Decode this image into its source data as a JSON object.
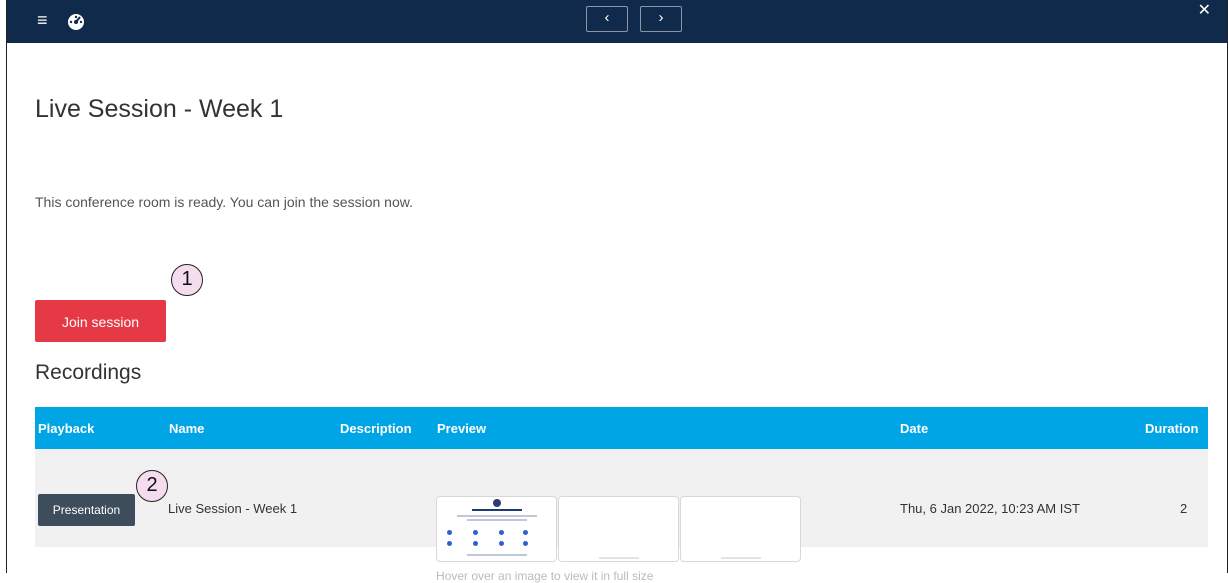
{
  "navbar": {
    "menu_glyph": "≡",
    "prev_glyph": "‹",
    "next_glyph": "›",
    "close_glyph": "✕"
  },
  "page": {
    "title": "Live Session - Week 1",
    "status_text": "This conference room is ready. You can join the session now.",
    "join_label": "Join session",
    "recordings_heading": "Recordings"
  },
  "callouts": [
    "1",
    "2"
  ],
  "table": {
    "headers": [
      "Playback",
      "Name",
      "Description",
      "Preview",
      "Date",
      "Duration"
    ],
    "rows": [
      {
        "playback_label": "Presentation",
        "name": "Live Session - Week 1",
        "description": "",
        "preview_hint": "Hover over an image to view it in full size",
        "date": "Thu, 6 Jan 2022, 10:23 AM IST",
        "duration": "2"
      }
    ]
  },
  "colors": {
    "navbar": "#0f2a4a",
    "join_button": "#e63946",
    "table_header": "#00a5e6",
    "playback_button": "#3d4d5c",
    "callout_fill": "#f6dcef"
  },
  "icons": [
    "hamburger-menu-icon",
    "dashboard-gauge-icon",
    "chevron-left-icon",
    "chevron-right-icon",
    "close-icon"
  ]
}
